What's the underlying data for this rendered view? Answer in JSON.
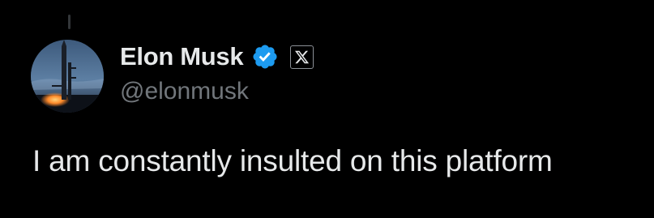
{
  "tweet": {
    "author": {
      "display_name": "Elon Musk",
      "handle": "@elonmusk",
      "verified_icon": "verified-badge-icon",
      "affiliation_icon": "x-logo-icon",
      "avatar_description": "rocket-launch-avatar"
    },
    "text": "I am constantly insulted on this platform"
  },
  "colors": {
    "background": "#000000",
    "text_primary": "#e7e9ea",
    "text_secondary": "#71767b",
    "verified_blue": "#1d9bf0",
    "thread_line": "#333639"
  }
}
